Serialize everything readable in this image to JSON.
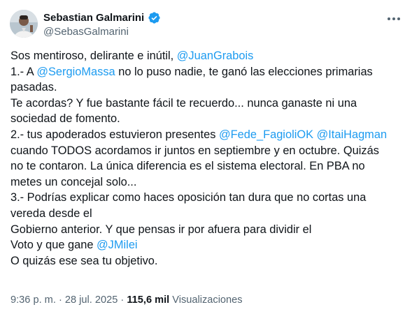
{
  "author": {
    "display_name": "Sebastian Galmarini",
    "handle": "@SebasGalmarini",
    "verified_color": "#1d9bf0"
  },
  "more_icon": "more-horizontal-icon",
  "tweet_lines": [
    [
      {
        "t": "Sos mentiroso, delirante e inútil, "
      },
      {
        "t": "@JuanGrabois",
        "m": true
      }
    ],
    [
      {
        "t": "1.- A "
      },
      {
        "t": "@SergioMassa",
        "m": true
      },
      {
        "t": " no lo puso nadie, te ganó las elecciones primarias"
      }
    ],
    [
      {
        "t": "pasadas."
      }
    ],
    [
      {
        "t": "Te acordas? Y fue bastante fácil te recuerdo... nunca ganaste ni una"
      }
    ],
    [
      {
        "t": "sociedad de fomento."
      }
    ],
    [
      {
        "t": "2.- tus apoderados estuvieron presentes "
      },
      {
        "t": "@Fede_FagioliOK",
        "m": true
      },
      {
        "t": " "
      },
      {
        "t": "@ItaiHagman",
        "m": true
      }
    ],
    [
      {
        "t": "cuando TODOS acordamos ir juntos en septiembre y en octubre. Quizás"
      }
    ],
    [
      {
        "t": "no te contaron. La única diferencia es el sistema electoral. En PBA no"
      }
    ],
    [
      {
        "t": "metes un concejal solo..."
      }
    ],
    [
      {
        "t": "3.- Podrías explicar como haces oposición tan dura que no cortas una"
      }
    ],
    [
      {
        "t": "vereda desde el"
      }
    ],
    [
      {
        "t": "Gobierno anterior. Y que pensas ir por afuera para dividir el"
      }
    ],
    [
      {
        "t": "Voto y que gane "
      },
      {
        "t": "@JMilei",
        "m": true
      }
    ],
    [
      {
        "t": "O quizás ese sea tu objetivo."
      }
    ]
  ],
  "meta": {
    "time": "9:36 p. m.",
    "separator": " · ",
    "date": "28 jul. 2025",
    "views_count": "115,6 mil",
    "views_label": " Visualizaciones"
  },
  "colors": {
    "text": "#0f1419",
    "secondary": "#536471",
    "mention": "#1d9bf0"
  }
}
